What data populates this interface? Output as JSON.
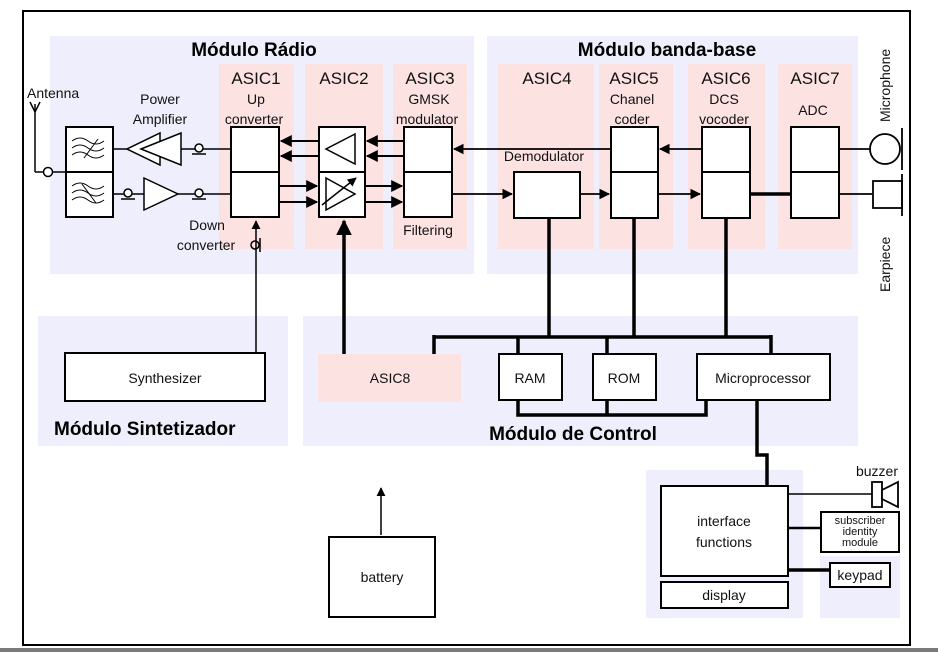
{
  "colors": {
    "module_bg": "#eeeefc",
    "asic_bg": "#fde2e2",
    "line": "#000000",
    "box_fill": "#ffffff",
    "text": "#000000"
  },
  "modules": {
    "radio": "Módulo Rádio",
    "baseband": "Módulo banda-base",
    "synth": "Módulo Sintetizador",
    "control": "Módulo de Control"
  },
  "asics": {
    "asic1": {
      "name": "ASIC1",
      "sub1": "Up",
      "sub2": "converter",
      "bottom1": "Down",
      "bottom2": "converter"
    },
    "asic2": {
      "name": "ASIC2"
    },
    "asic3": {
      "name": "ASIC3",
      "sub1": "GMSK",
      "sub2": "modulator",
      "bottom": "Filtering"
    },
    "asic4": {
      "name": "ASIC4",
      "sub1": "Demodulator"
    },
    "asic5": {
      "name": "ASIC5",
      "sub1": "Chanel",
      "sub2": "coder"
    },
    "asic6": {
      "name": "ASIC6",
      "sub1": "DCS",
      "sub2": "vocoder"
    },
    "asic7": {
      "name": "ASIC7",
      "sub1": "ADC"
    },
    "asic8": {
      "name": "ASIC8"
    }
  },
  "labels": {
    "antenna": "Antenna",
    "power_amp_1": "Power",
    "power_amp_2": "Amplifier",
    "microphone": "Microphone",
    "earpiece": "Earpiece",
    "synthesizer": "Synthesizer",
    "ram": "RAM",
    "rom": "ROM",
    "microprocessor": "Microprocessor",
    "battery": "battery",
    "interface_1": "interface",
    "interface_2": "functions",
    "display": "display",
    "buzzer": "buzzer",
    "sim_1": "subscriber",
    "sim_2": "identity",
    "sim_3": "module",
    "keypad": "keypad"
  }
}
